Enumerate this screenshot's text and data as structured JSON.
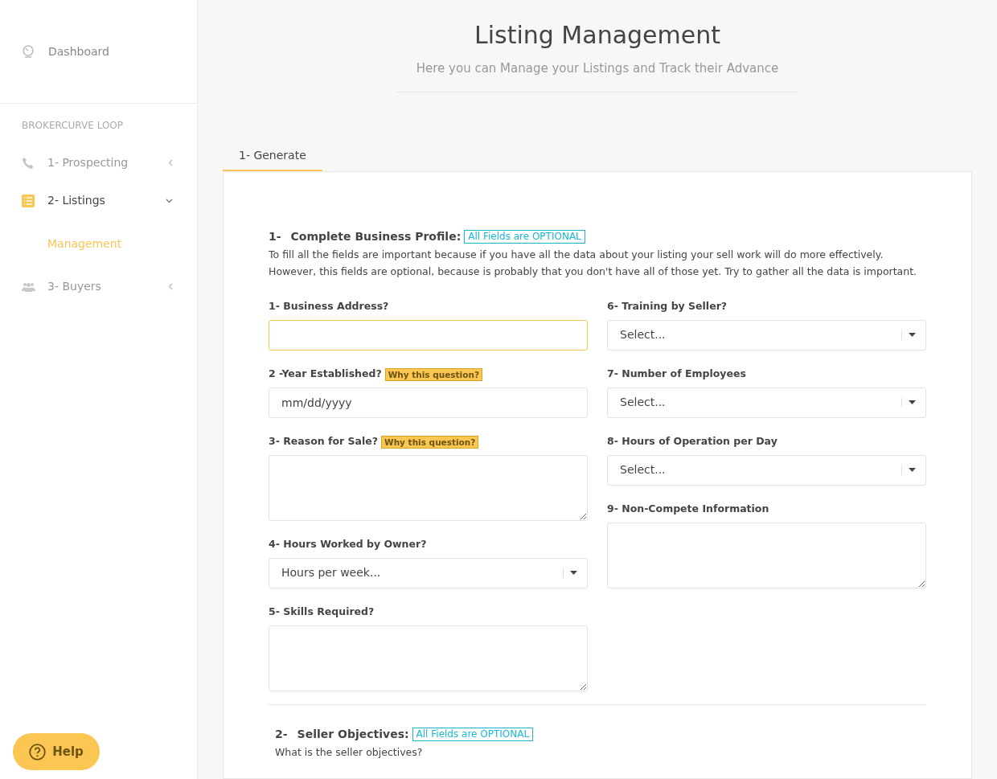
{
  "sidebar": {
    "top_item": {
      "label": "Dashboard",
      "kind": "gauge"
    },
    "section_heading": "BROKERCURVE LOOP",
    "items": [
      {
        "label": "1- Prospecting",
        "kind": "phone",
        "expanded": false
      },
      {
        "label": "2- Listings",
        "kind": "list",
        "expanded": true,
        "children": [
          {
            "label": "Management",
            "selected": true
          }
        ]
      },
      {
        "label": "3- Buyers",
        "kind": "users",
        "expanded": false
      }
    ],
    "help_button": "Help"
  },
  "header": {
    "title": "Listing Management",
    "subtitle": "Here you can Manage your Listings and Track their Advance"
  },
  "tabs": [
    {
      "label": "1- Generate",
      "selected": true
    }
  ],
  "sections": [
    {
      "number": "1-",
      "title": "Complete Business Profile:",
      "badge": "All Fields are OPTIONAL",
      "description": "To fill all the fields are important because if you have all the data about your listing your sell work will do more effectively. However, this fields are optional, because is probably that you don't have all of those yet. Try to gather all the data is important.",
      "left_fields": [
        {
          "label": "1- Business Address?",
          "kind": "text",
          "focused": true
        },
        {
          "label": "2 -Year Established?",
          "kind": "date",
          "placeholder": "mm/dd/yyyy",
          "hint": "Why this question?",
          "focused": false
        },
        {
          "label": "3- Reason for Sale?",
          "kind": "textarea",
          "hint": "Why this question?",
          "focused": false
        },
        {
          "label": "4- Hours Worked by Owner?",
          "kind": "select",
          "placeholder": "Hours per week...",
          "focused": false
        },
        {
          "label": "5- Skills Required?",
          "kind": "textarea",
          "focused": false
        }
      ],
      "right_fields": [
        {
          "label": "6- Training by Seller?",
          "kind": "select",
          "placeholder": "Select...",
          "focused": false
        },
        {
          "label": "7- Number of Employees",
          "kind": "select",
          "placeholder": "Select...",
          "focused": false
        },
        {
          "label": "8- Hours of Operation per Day",
          "kind": "select",
          "placeholder": "Select...",
          "focused": false
        },
        {
          "label": "9- Non-Compete Information",
          "kind": "textarea",
          "focused": false
        }
      ]
    },
    {
      "number": "2-",
      "title": "Seller Objectives:",
      "badge": "All Fields are OPTIONAL",
      "description": "What is the seller objectives?"
    }
  ]
}
